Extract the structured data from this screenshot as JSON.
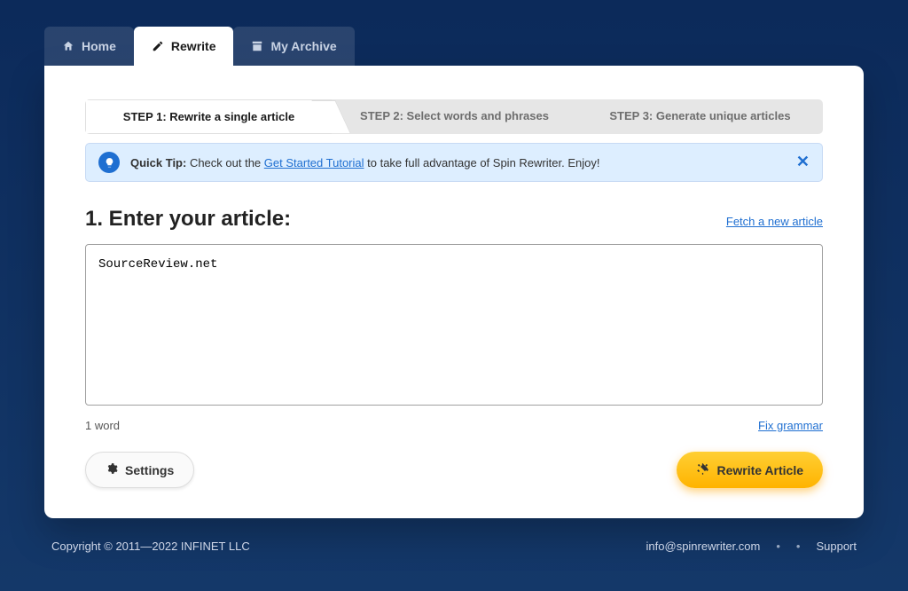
{
  "tabs": {
    "home": "Home",
    "rewrite": "Rewrite",
    "archive": "My Archive"
  },
  "steps": {
    "s1": "STEP 1: Rewrite a single article",
    "s2": "STEP 2: Select words and phrases",
    "s3": "STEP 3: Generate unique articles"
  },
  "tip": {
    "label": "Quick Tip:",
    "before": " Check out the ",
    "link": "Get Started Tutorial",
    "after": " to take full advantage of Spin Rewriter. Enjoy!"
  },
  "heading": "1. Enter your article:",
  "fetch_link": "Fetch a new article",
  "textarea_value": "SourceReview.net",
  "word_count": "1 word",
  "fix_grammar": "Fix grammar",
  "settings_btn": "Settings",
  "rewrite_btn": "Rewrite Article",
  "footer": {
    "copyright": "Copyright © 2011—2022 INFINET LLC",
    "email": "info@spinrewriter.com",
    "support": "Support"
  }
}
